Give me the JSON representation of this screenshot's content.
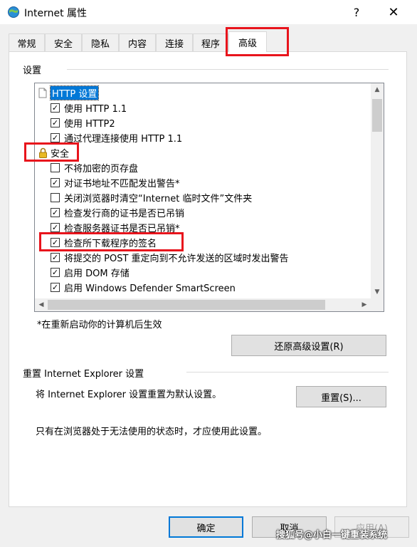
{
  "window": {
    "title": "Internet 属性",
    "help": "?",
    "close": "✕"
  },
  "tabs": [
    {
      "label": "常规"
    },
    {
      "label": "安全"
    },
    {
      "label": "隐私"
    },
    {
      "label": "内容"
    },
    {
      "label": "连接"
    },
    {
      "label": "程序"
    },
    {
      "label": "高级"
    }
  ],
  "active_tab": "高级",
  "settings": {
    "group_label": "设置",
    "items": [
      {
        "type": "header",
        "icon": "document-icon",
        "label": "HTTP 设置",
        "selected": true
      },
      {
        "type": "check",
        "checked": true,
        "label": "使用 HTTP 1.1"
      },
      {
        "type": "check",
        "checked": true,
        "label": "使用 HTTP2"
      },
      {
        "type": "check",
        "checked": true,
        "label": "通过代理连接使用 HTTP 1.1"
      },
      {
        "type": "header",
        "icon": "lock-icon",
        "label": "安全"
      },
      {
        "type": "check",
        "checked": false,
        "label": "不将加密的页存盘"
      },
      {
        "type": "check",
        "checked": true,
        "label": "对证书地址不匹配发出警告*"
      },
      {
        "type": "check",
        "checked": false,
        "label": "关闭浏览器时清空“Internet 临时文件”文件夹"
      },
      {
        "type": "check",
        "checked": true,
        "label": "检查发行商的证书是否已吊销"
      },
      {
        "type": "check",
        "checked": true,
        "label": "检查服务器证书是否已吊销*"
      },
      {
        "type": "check",
        "checked": true,
        "label": "检查所下载程序的签名"
      },
      {
        "type": "check",
        "checked": true,
        "label": "将提交的 POST 重定向到不允许发送的区域时发出警告"
      },
      {
        "type": "check",
        "checked": true,
        "label": "启用 DOM 存储"
      },
      {
        "type": "check",
        "checked": true,
        "label": "启用 Windows Defender SmartScreen"
      }
    ],
    "restart_note": "*在重新启动你的计算机后生效",
    "restore_button": "还原高级设置(R)"
  },
  "reset": {
    "group_label": "重置 Internet Explorer 设置",
    "description": "将 Internet Explorer 设置重置为默认设置。",
    "button": "重置(S)...",
    "note": "只有在浏览器处于无法使用的状态时，才应使用此设置。"
  },
  "footer": {
    "ok": "确定",
    "cancel": "取消",
    "apply": "应用(A)"
  },
  "watermark": "搜狐号@小白一键重装系统",
  "colors": {
    "annotation": "#e8141c",
    "selection": "#0078d7"
  }
}
